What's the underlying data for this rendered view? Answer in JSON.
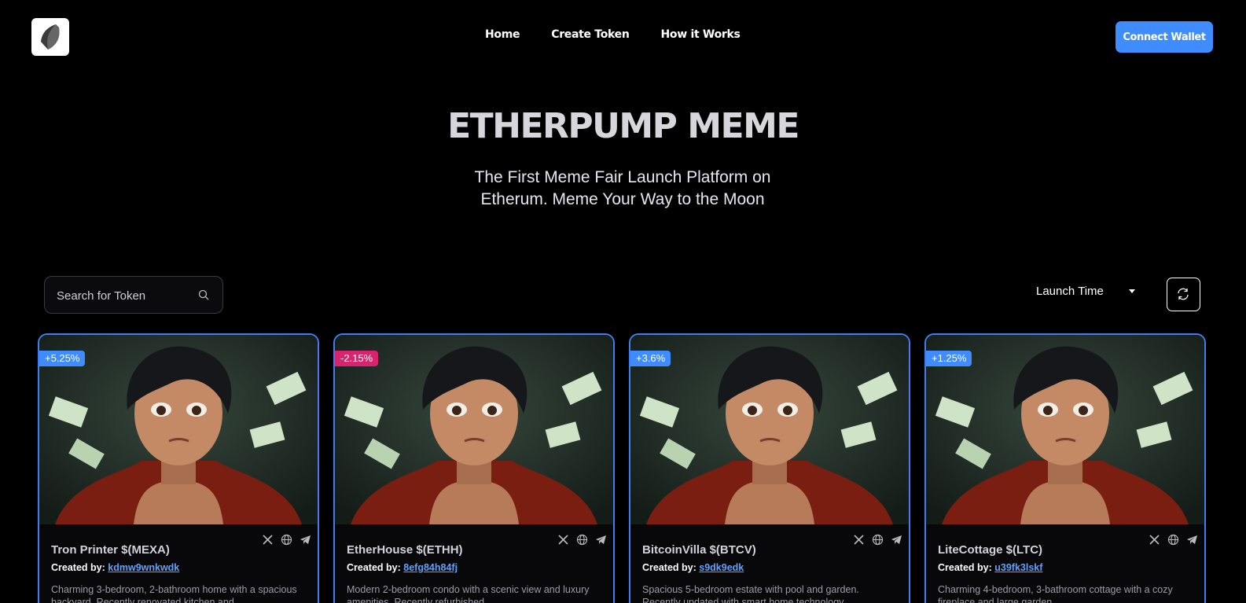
{
  "nav": {
    "links": [
      "Home",
      "Create Token",
      "How it Works"
    ],
    "connect_label": "Connect Wallet"
  },
  "hero": {
    "title": "ETHERPUMP MEME",
    "subtitle": "The First Meme Fair Launch Platform on Etherum. Meme Your Way to the Moon"
  },
  "search": {
    "placeholder": "Search for Token"
  },
  "sort": {
    "label": "Launch Time"
  },
  "colors": {
    "accent": "#3f8cff",
    "negative": "#d7246d",
    "background": "#000000"
  },
  "cards": [
    {
      "change": "+5.25%",
      "trend": "up",
      "name": "Tron Printer $(MEXA)",
      "created_by_label": "Created by:",
      "creator": "kdmw9wnkwdk",
      "description": "Charming 3-bedroom, 2-bathroom home with a spacious backyard. Recently renovated kitchen and..."
    },
    {
      "change": "-2.15%",
      "trend": "down",
      "name": "EtherHouse $(ETHH)",
      "created_by_label": "Created by:",
      "creator": "8efg84h84fj",
      "description": "Modern 2-bedroom condo with a scenic view and luxury amenities. Recently refurbished..."
    },
    {
      "change": "+3.6%",
      "trend": "up",
      "name": "BitcoinVilla $(BTCV)",
      "created_by_label": "Created by:",
      "creator": "s9dk9edk",
      "description": "Spacious 5-bedroom estate with pool and garden. Recently updated with smart home technology..."
    },
    {
      "change": "+1.25%",
      "trend": "up",
      "name": "LiteCottage $(LTC)",
      "created_by_label": "Created by:",
      "creator": "u39fk3lskf",
      "description": "Charming 4-bedroom, 3-bathroom cottage with a cozy fireplace and large garden..."
    }
  ],
  "icons": {
    "logo": "leaf-logo-icon",
    "search": "search-icon",
    "sort": "caret-down-icon",
    "refresh": "refresh-icon",
    "socials": [
      "x-icon",
      "globe-icon",
      "telegram-icon"
    ]
  }
}
